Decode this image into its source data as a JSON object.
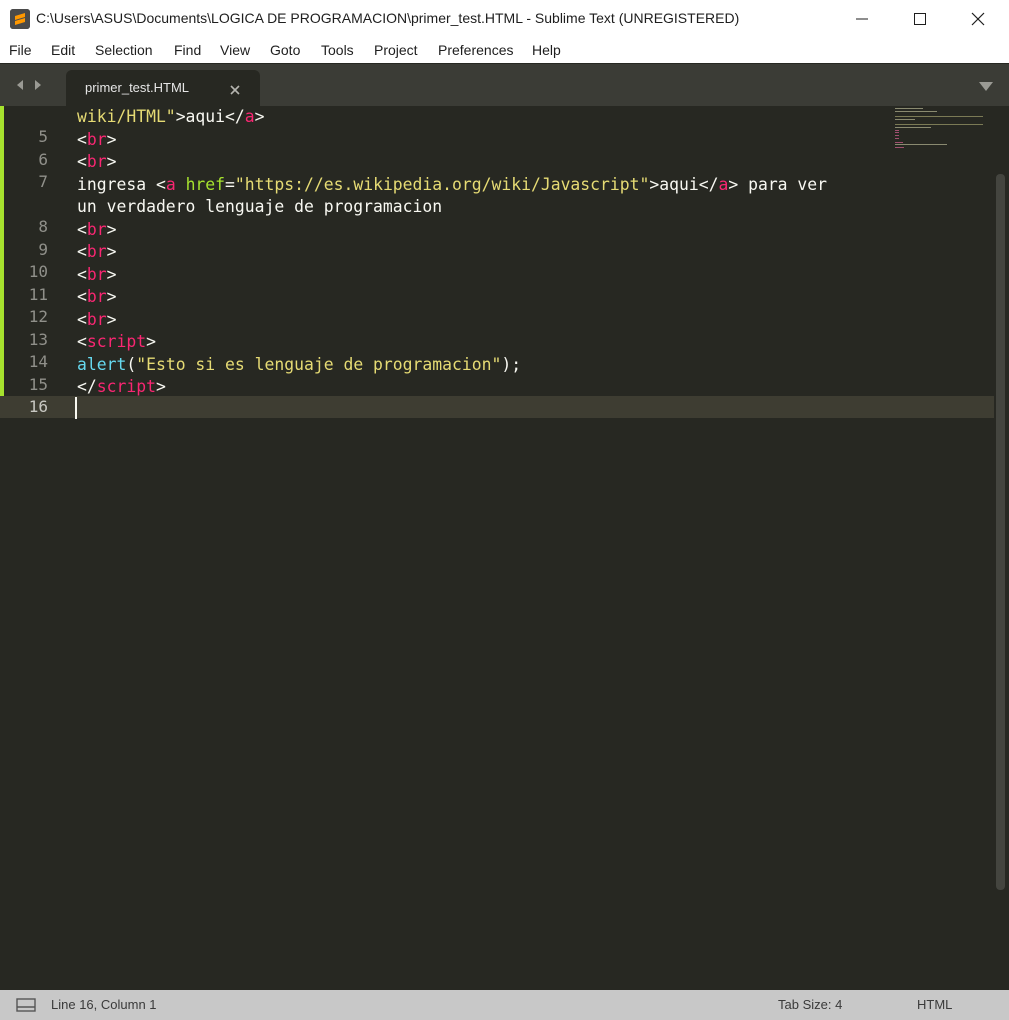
{
  "window": {
    "title": "C:\\Users\\ASUS\\Documents\\LOGICA DE PROGRAMACION\\primer_test.HTML - Sublime Text (UNREGISTERED)",
    "app_icon": "sublime-text-icon"
  },
  "menu": {
    "items": [
      {
        "label": "File"
      },
      {
        "label": "Edit"
      },
      {
        "label": "Selection"
      },
      {
        "label": "Find"
      },
      {
        "label": "View"
      },
      {
        "label": "Goto"
      },
      {
        "label": "Tools"
      },
      {
        "label": "Project"
      },
      {
        "label": "Preferences"
      },
      {
        "label": "Help"
      }
    ]
  },
  "tabs": [
    {
      "label": "primer_test.HTML",
      "active": true
    }
  ],
  "editor": {
    "line_numbers": [
      "5",
      "6",
      "7",
      "8",
      "9",
      "10",
      "11",
      "12",
      "13",
      "14",
      "15",
      "16"
    ],
    "current_line": "16",
    "code_lines": [
      [
        {
          "t": "str",
          "v": "wiki/HTML\""
        },
        {
          "t": "txt",
          "v": ">aqui</"
        },
        {
          "t": "tag",
          "v": "a"
        },
        {
          "t": "txt",
          "v": ">"
        }
      ],
      [
        {
          "t": "txt",
          "v": "<"
        },
        {
          "t": "tag",
          "v": "br"
        },
        {
          "t": "txt",
          "v": ">"
        }
      ],
      [
        {
          "t": "txt",
          "v": "<"
        },
        {
          "t": "tag",
          "v": "br"
        },
        {
          "t": "txt",
          "v": ">"
        }
      ],
      [
        {
          "t": "txt",
          "v": "ingresa <"
        },
        {
          "t": "tag",
          "v": "a"
        },
        {
          "t": "txt",
          "v": " "
        },
        {
          "t": "attr",
          "v": "href"
        },
        {
          "t": "txt",
          "v": "="
        },
        {
          "t": "str",
          "v": "\"https://es.wikipedia.org/wiki/Javascript\""
        },
        {
          "t": "txt",
          "v": ">aqui</"
        },
        {
          "t": "tag",
          "v": "a"
        },
        {
          "t": "txt",
          "v": "> para ver"
        }
      ],
      [
        {
          "t": "txt",
          "v": "un verdadero lenguaje de programacion"
        }
      ],
      [
        {
          "t": "txt",
          "v": "<"
        },
        {
          "t": "tag",
          "v": "br"
        },
        {
          "t": "txt",
          "v": ">"
        }
      ],
      [
        {
          "t": "txt",
          "v": "<"
        },
        {
          "t": "tag",
          "v": "br"
        },
        {
          "t": "txt",
          "v": ">"
        }
      ],
      [
        {
          "t": "txt",
          "v": "<"
        },
        {
          "t": "tag",
          "v": "br"
        },
        {
          "t": "txt",
          "v": ">"
        }
      ],
      [
        {
          "t": "txt",
          "v": "<"
        },
        {
          "t": "tag",
          "v": "br"
        },
        {
          "t": "txt",
          "v": ">"
        }
      ],
      [
        {
          "t": "txt",
          "v": "<"
        },
        {
          "t": "tag",
          "v": "br"
        },
        {
          "t": "txt",
          "v": ">"
        }
      ],
      [
        {
          "t": "txt",
          "v": "<"
        },
        {
          "t": "tag",
          "v": "script"
        },
        {
          "t": "txt",
          "v": ">"
        }
      ],
      [
        {
          "t": "fn",
          "v": "alert"
        },
        {
          "t": "txt",
          "v": "("
        },
        {
          "t": "str",
          "v": "\"Esto si es lenguaje de programacion\""
        },
        {
          "t": "txt",
          "v": ");"
        }
      ],
      [
        {
          "t": "txt",
          "v": "</"
        },
        {
          "t": "tag",
          "v": "script"
        },
        {
          "t": "txt",
          "v": ">"
        }
      ],
      [
        {
          "t": "txt",
          "v": ""
        }
      ]
    ]
  },
  "status": {
    "position": "Line 16, Column 1",
    "tab_size": "Tab Size: 4",
    "syntax": "HTML"
  },
  "colors": {
    "editor_bg": "#272822",
    "tag": "#f92672",
    "attribute": "#a6e22e",
    "string": "#e6db74",
    "function": "#66d9ef",
    "text": "#f8f8f2",
    "modified_marker": "#a6e22e"
  }
}
